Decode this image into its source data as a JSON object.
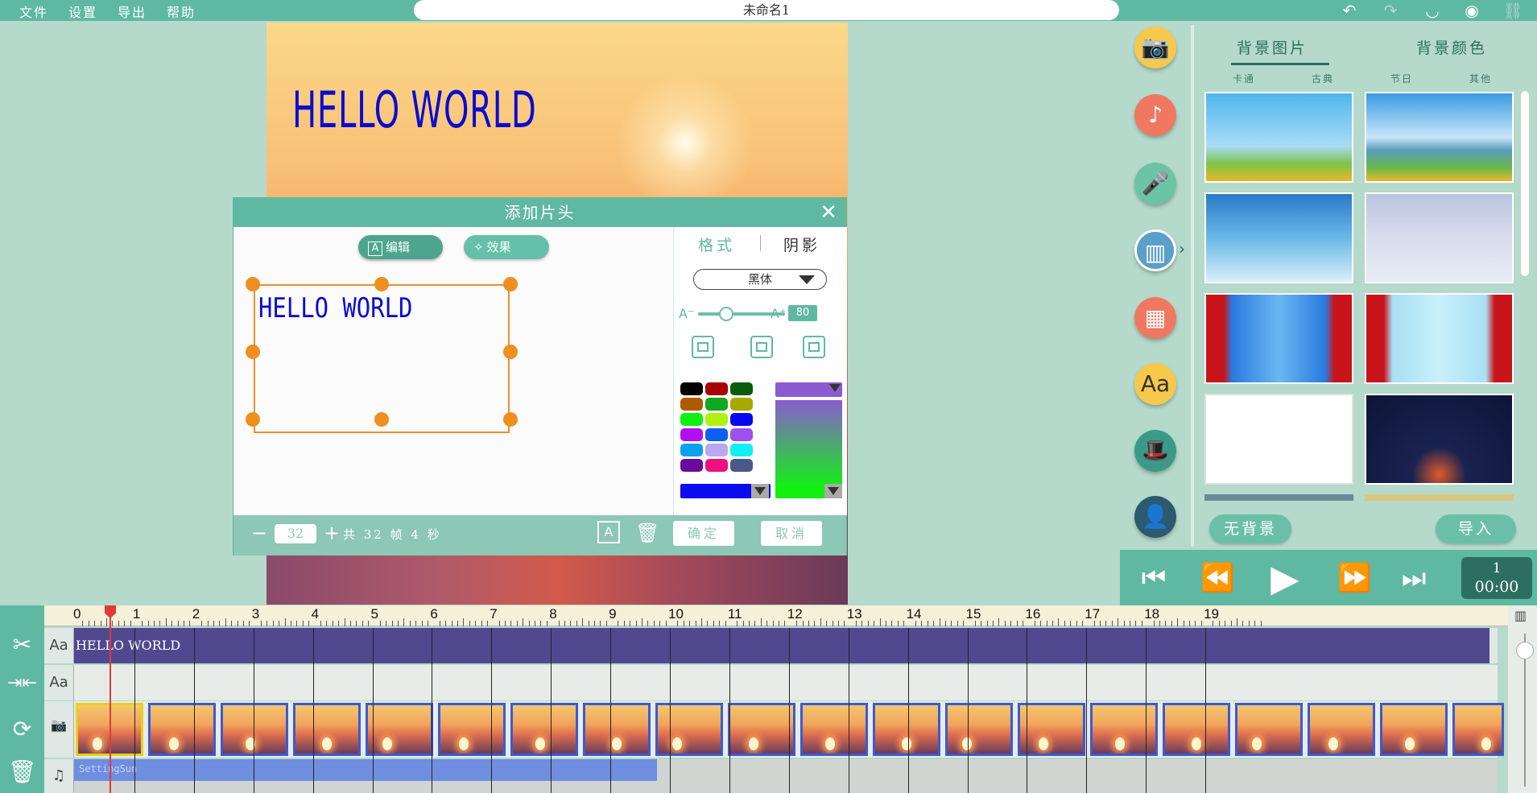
{
  "menu": [
    "文件",
    "设置",
    "导出",
    "帮助"
  ],
  "document_title": "未命名1",
  "top_icons": [
    "undo-icon",
    "redo-icon",
    "eye-icon",
    "user-icon",
    "link-icon"
  ],
  "preview": {
    "title_text": "HELLO WORLD",
    "title_color": "#0b0bd0"
  },
  "dialog": {
    "title": "添加片头",
    "tabs": {
      "edit": "编辑",
      "effect": "效果"
    },
    "text_content": "HELLO WORLD",
    "format_tab": "格式",
    "shadow_tab": "阴影",
    "font": "黑体",
    "size_min_label": "A⁻",
    "size_max_label": "A⁺",
    "font_size": "80",
    "swatches": [
      "#000000",
      "#a80000",
      "#0a5c0a",
      "#b05a00",
      "#0fa81f",
      "#a8a800",
      "#0ff010",
      "#b0f012",
      "#0808f0",
      "#b010f0",
      "#0c60f0",
      "#a050f0",
      "#08a0f0",
      "#b8a8f0",
      "#10f0f0",
      "#6a0a9a",
      "#f01080",
      "#4a5888"
    ],
    "custom_color": "#8a5cd0",
    "gradient_end": "#12f012",
    "current_fill": "#0b0bf0",
    "current_outline": "#12f012",
    "frame_count": "32",
    "summary": "共 32 帧 4 秒",
    "confirm": "确定",
    "cancel": "取消"
  },
  "tools": [
    "camera-icon",
    "music-icon",
    "microphone-icon",
    "filmstrip-icon",
    "clip-icon",
    "text-icon",
    "magic-hat-icon",
    "avatar-icon"
  ],
  "bg_panel": {
    "tab_image": "背景图片",
    "tab_color": "背景颜色",
    "subtabs": [
      "卡通",
      "古典",
      "节日",
      "其他"
    ],
    "no_background": "无背景",
    "import": "导入"
  },
  "timecode": {
    "frame": "1",
    "time": "00:00"
  },
  "timeline": {
    "ticks": [
      "0",
      "1",
      "2",
      "3",
      "4",
      "5",
      "6",
      "7",
      "8",
      "9",
      "10",
      "11",
      "12",
      "13",
      "14",
      "15",
      "16",
      "17",
      "18",
      "19"
    ],
    "title_track_text": "HELLO WORLD",
    "audio_label": "SettingSun",
    "playhead_seconds": 0.45
  }
}
